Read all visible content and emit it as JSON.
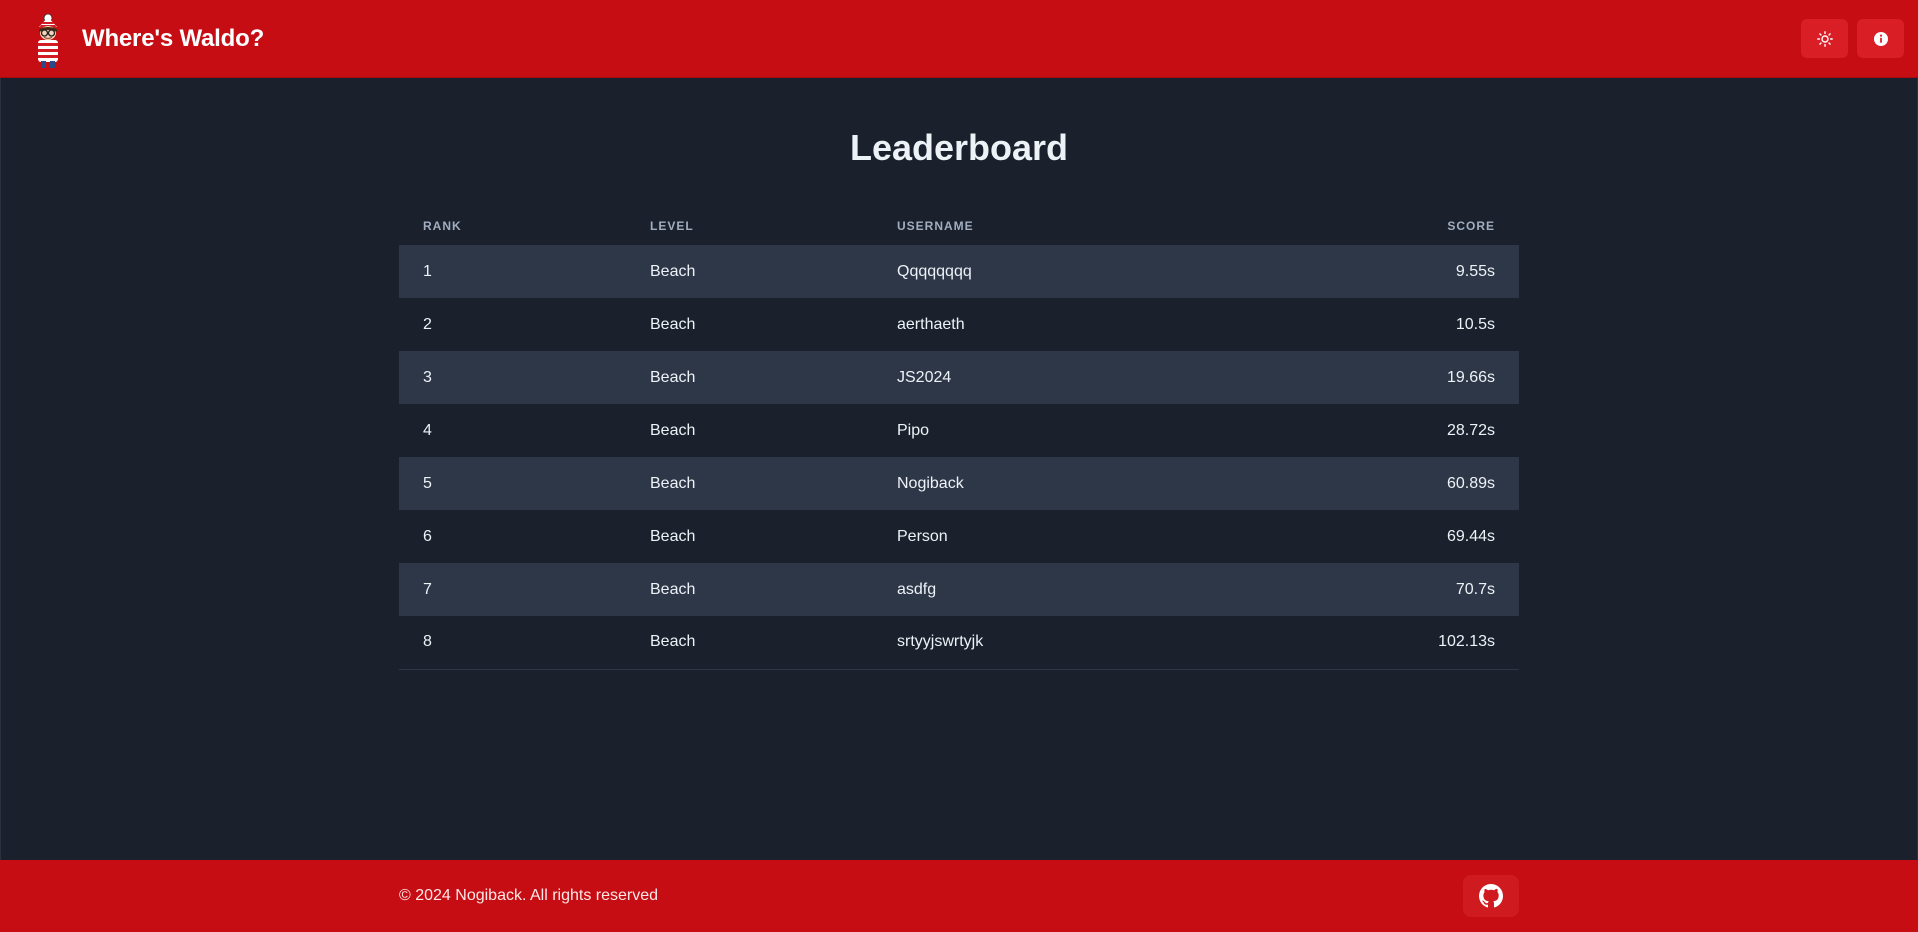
{
  "header": {
    "title": "Where's Waldo?",
    "logo_icon": "waldo-logo-icon",
    "theme_toggle_icon": "sun-icon",
    "info_icon": "info-icon",
    "brand_color": "#c60d13"
  },
  "main": {
    "title": "Leaderboard",
    "columns": [
      "RANK",
      "LEVEL",
      "USERNAME",
      "SCORE"
    ],
    "rows": [
      {
        "rank": "1",
        "level": "Beach",
        "username": "Qqqqqqqq",
        "score": "9.55s"
      },
      {
        "rank": "2",
        "level": "Beach",
        "username": "aerthaeth",
        "score": "10.5s"
      },
      {
        "rank": "3",
        "level": "Beach",
        "username": "JS2024",
        "score": "19.66s"
      },
      {
        "rank": "4",
        "level": "Beach",
        "username": "Pipo",
        "score": "28.72s"
      },
      {
        "rank": "5",
        "level": "Beach",
        "username": "Nogiback",
        "score": "60.89s"
      },
      {
        "rank": "6",
        "level": "Beach",
        "username": "Person",
        "score": "69.44s"
      },
      {
        "rank": "7",
        "level": "Beach",
        "username": "asdfg",
        "score": "70.7s"
      },
      {
        "rank": "8",
        "level": "Beach",
        "username": "srtyyjswrtyjk",
        "score": "102.13s"
      }
    ]
  },
  "footer": {
    "copyright": "© 2024 Nogiback. All rights reserved",
    "github_icon": "github-icon"
  }
}
